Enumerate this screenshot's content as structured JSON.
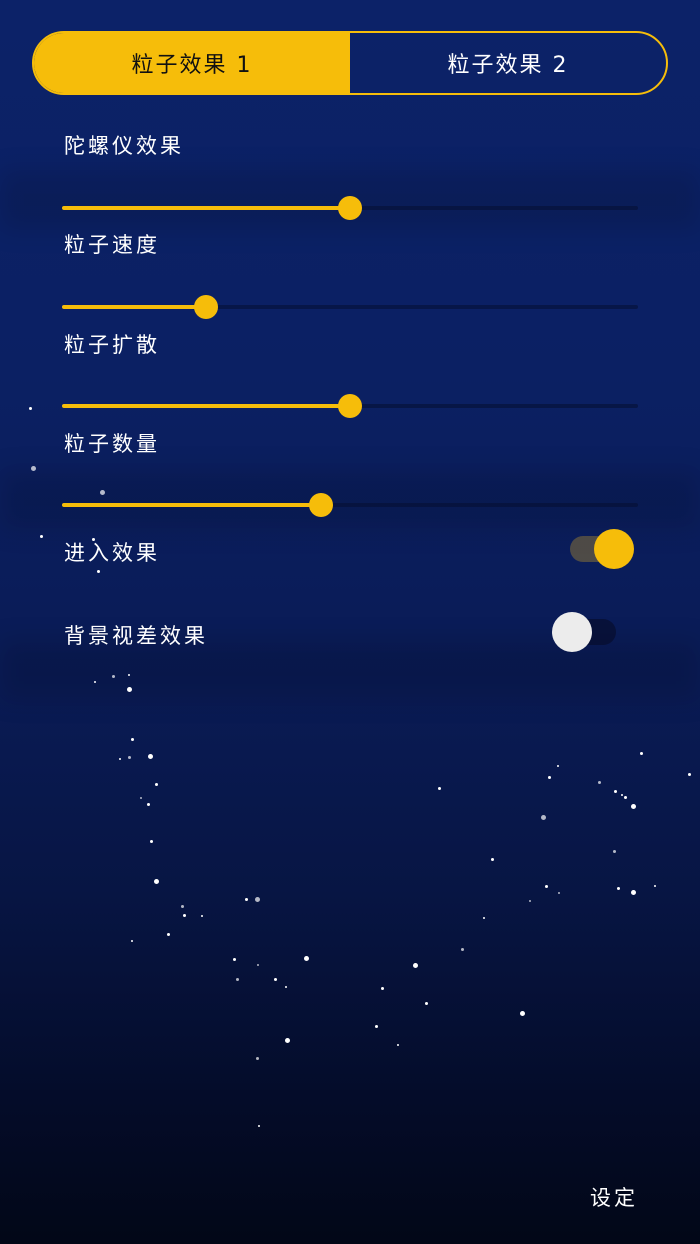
{
  "tabs": [
    {
      "label": "粒子效果 1",
      "active": true
    },
    {
      "label": "粒子效果 2",
      "active": false
    }
  ],
  "settings": {
    "gyro": {
      "label": "陀螺仪效果",
      "value": 0.5
    },
    "speed": {
      "label": "粒子速度",
      "value": 0.25
    },
    "spread": {
      "label": "粒子扩散",
      "value": 0.5
    },
    "count": {
      "label": "粒子数量",
      "value": 0.45
    },
    "entry_effect": {
      "label": "进入效果",
      "on": true
    },
    "parallax": {
      "label": "背景视差效果",
      "on": false
    }
  },
  "footer": {
    "settings_label": "设定"
  },
  "colors": {
    "accent": "#f6bd0a",
    "background_top": "#0c2268",
    "background_bottom": "#020717",
    "text": "#ffffff"
  },
  "icons": {
    "background": "starfield-particles"
  }
}
